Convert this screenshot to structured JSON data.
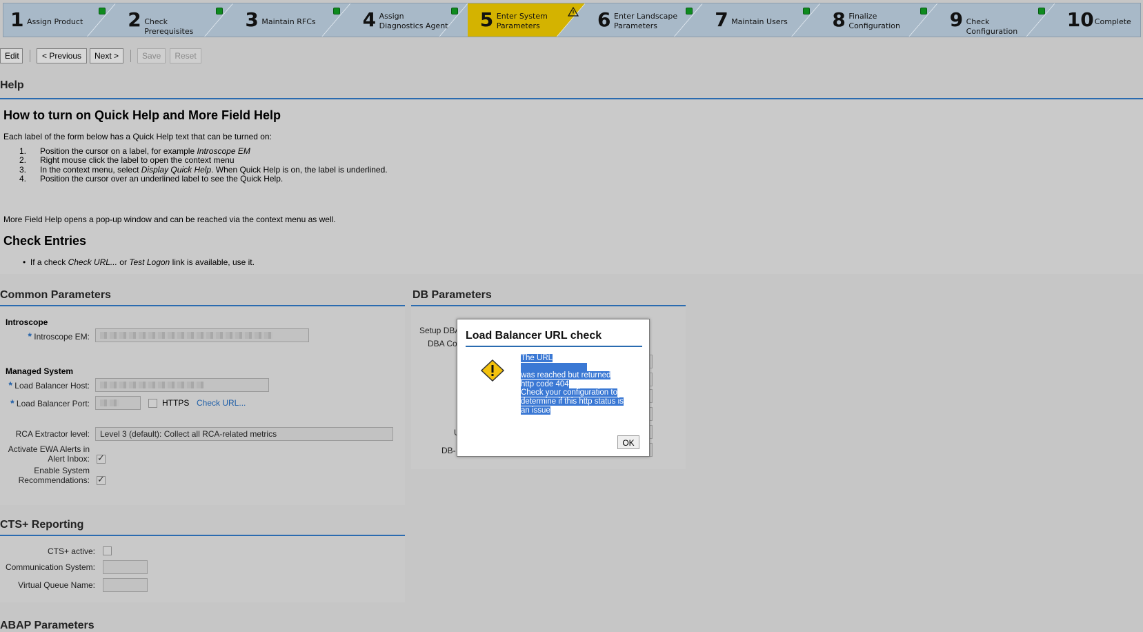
{
  "roadmap": {
    "steps": [
      {
        "num": "1",
        "label": "Assign Product",
        "status": "ok"
      },
      {
        "num": "2",
        "label": "Check Prerequisites",
        "status": "ok"
      },
      {
        "num": "3",
        "label": "Maintain RFCs",
        "status": "ok"
      },
      {
        "num": "4",
        "label": "Assign Diagnostics Agent",
        "status": "ok"
      },
      {
        "num": "5",
        "label": "Enter System Parameters",
        "status": "warning"
      },
      {
        "num": "6",
        "label": "Enter Landscape Parameters",
        "status": "ok"
      },
      {
        "num": "7",
        "label": "Maintain Users",
        "status": "ok"
      },
      {
        "num": "8",
        "label": "Finalize Configuration",
        "status": "ok"
      },
      {
        "num": "9",
        "label": "Check Configuration",
        "status": "ok"
      },
      {
        "num": "10",
        "label": "Complete",
        "status": "ok"
      }
    ],
    "active_color": "#d4b300"
  },
  "toolbar": {
    "edit": "Edit",
    "previous": "< Previous",
    "next": "Next >",
    "save": "Save",
    "reset": "Reset"
  },
  "help": {
    "section_title": "Help",
    "heading": "How to turn on Quick Help and More Field Help",
    "intro": "Each label of the form below has a Quick Help text that can be turned on:",
    "steps": [
      {
        "n": "1.",
        "pre": "Position the cursor on a label, for example ",
        "em": "Introscope EM",
        "post": ""
      },
      {
        "n": "2.",
        "pre": "Right mouse click the label to open the context menu",
        "em": "",
        "post": ""
      },
      {
        "n": "3.",
        "pre": "In the context menu, select ",
        "em": "Display Quick Help",
        "post": ". When Quick Help is on, the label is underlined."
      },
      {
        "n": "4.",
        "pre": "Position the cursor over an underlined label to see the Quick Help.",
        "em": "",
        "post": ""
      }
    ],
    "more": "More Field Help opens a pop-up window and can be reached via the context menu as well.",
    "check_heading": "Check Entries",
    "check_pre": "If a check ",
    "check_em1": "Check URL...",
    "check_mid": " or ",
    "check_em2": "Test Logon",
    "check_post": " link is available, use it."
  },
  "common": {
    "title": "Common Parameters",
    "introscope_group": "Introscope",
    "introscope_em_label": "Introscope EM:",
    "managed_group": "Managed System",
    "lb_host_label": "Load Balancer Host:",
    "lb_port_label": "Load Balancer Port:",
    "https_label": "HTTPS",
    "check_url": "Check URL...",
    "rca_label": "RCA Extractor level:",
    "rca_value": "Level 3 (default): Collect all RCA-related metrics",
    "ewa_label_1": "Activate EWA Alerts in",
    "ewa_label_2": "Alert Inbox:",
    "recs_label_1": "Enable System",
    "recs_label_2": "Recommendations:"
  },
  "db": {
    "title": "DB Parameters",
    "setup_label": "Setup DBA",
    "dba_label": "DBA Co",
    "u_label": "U",
    "db_label": "DB-"
  },
  "cts": {
    "title": "CTS+ Reporting",
    "active_label": "CTS+ active:",
    "comm_label": "Communication System:",
    "queue_label": "Virtual Queue Name:"
  },
  "abap": {
    "title": "ABAP Parameters"
  },
  "modal": {
    "title": "Load Balancer URL check",
    "lines": [
      "The URL",
      "",
      "was reached but returned",
      "http code 404",
      "Check your configuration to",
      "determine if this http status is",
      "an issue"
    ],
    "ok": "OK"
  }
}
